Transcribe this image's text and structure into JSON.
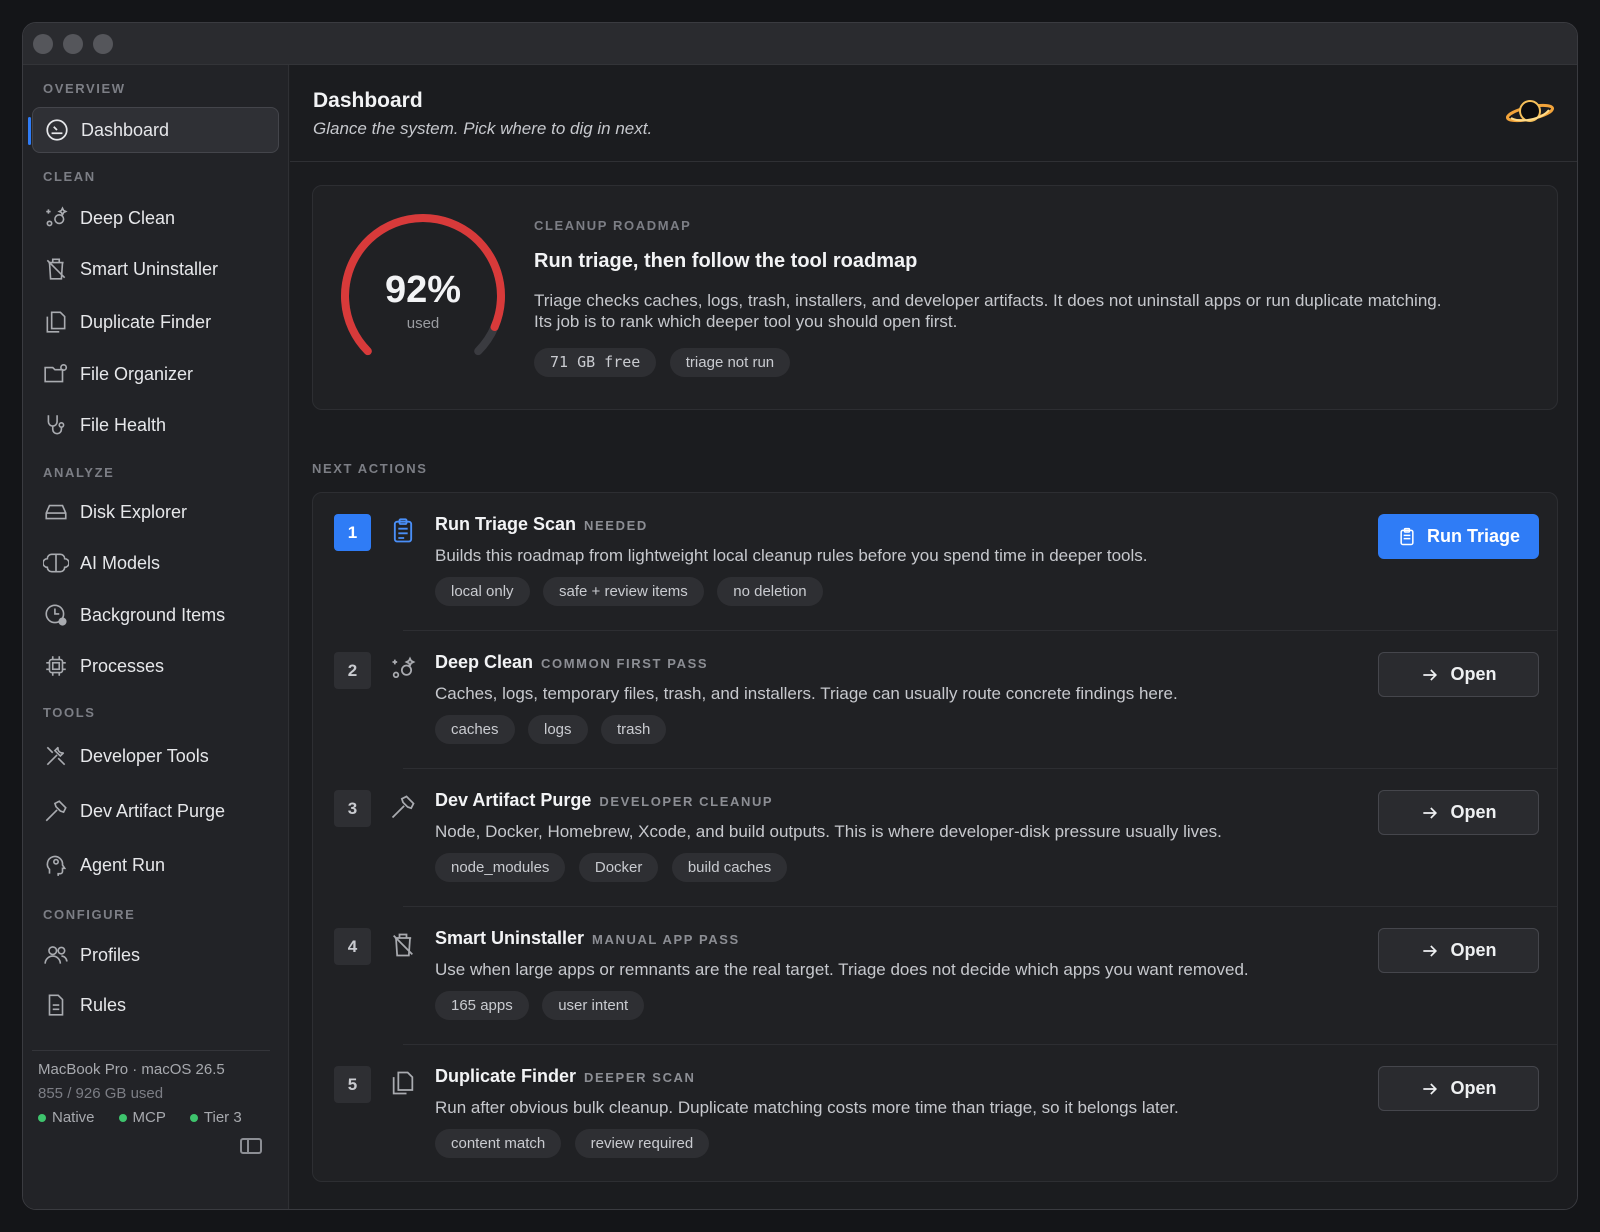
{
  "sidebar": {
    "sections": [
      "OVERVIEW",
      "CLEAN",
      "ANALYZE",
      "TOOLS",
      "CONFIGURE"
    ],
    "items": [
      {
        "label": "Dashboard",
        "icon": "gauge-icon",
        "active": true
      },
      {
        "label": "Deep Clean",
        "icon": "sparkles-icon"
      },
      {
        "label": "Smart Uninstaller",
        "icon": "trash-icon"
      },
      {
        "label": "Duplicate Finder",
        "icon": "documents-icon"
      },
      {
        "label": "File Organizer",
        "icon": "folder-gear-icon"
      },
      {
        "label": "File Health",
        "icon": "stethoscope-icon"
      },
      {
        "label": "Disk Explorer",
        "icon": "drive-icon"
      },
      {
        "label": "AI Models",
        "icon": "brain-icon"
      },
      {
        "label": "Background Items",
        "icon": "clock-badge-icon"
      },
      {
        "label": "Processes",
        "icon": "cpu-icon"
      },
      {
        "label": "Developer Tools",
        "icon": "tools-icon"
      },
      {
        "label": "Dev Artifact Purge",
        "icon": "hammer-icon"
      },
      {
        "label": "Agent Run",
        "icon": "agent-head-icon"
      },
      {
        "label": "Profiles",
        "icon": "people-icon"
      },
      {
        "label": "Rules",
        "icon": "document-icon"
      }
    ],
    "footer": {
      "device": "MacBook Pro · macOS 26.5",
      "usage": "855 / 926 GB used",
      "status": [
        "Native",
        "MCP",
        "Tier 3"
      ]
    }
  },
  "header": {
    "title": "Dashboard",
    "subtitle": "Glance the system. Pick where to dig in next."
  },
  "roadmap": {
    "gauge_value": "92%",
    "gauge_label": "used",
    "gauge_fraction": 0.92,
    "eyebrow": "CLEANUP ROADMAP",
    "title": "Run triage, then follow the tool roadmap",
    "desc1": "Triage checks caches, logs, trash, installers, and developer artifacts. It does not uninstall apps or run duplicate matching.",
    "desc2": "Its job is to rank which deeper tool you should open first.",
    "pills": [
      "71 GB free",
      "triage not run"
    ]
  },
  "next_actions_label": "NEXT ACTIONS",
  "actions": [
    {
      "num": "1",
      "title": "Run Triage Scan",
      "tag": "NEEDED",
      "desc": "Builds this roadmap from lightweight local cleanup rules before you spend time in deeper tools.",
      "pills": [
        "local only",
        "safe + review items",
        "no deletion"
      ],
      "button": "Run Triage"
    },
    {
      "num": "2",
      "title": "Deep Clean",
      "tag": "COMMON FIRST PASS",
      "desc": "Caches, logs, temporary files, trash, and installers. Triage can usually route concrete findings here.",
      "pills": [
        "caches",
        "logs",
        "trash"
      ],
      "button": "Open"
    },
    {
      "num": "3",
      "title": "Dev Artifact Purge",
      "tag": "DEVELOPER CLEANUP",
      "desc": "Node, Docker, Homebrew, Xcode, and build outputs. This is where developer-disk pressure usually lives.",
      "pills": [
        "node_modules",
        "Docker",
        "build caches"
      ],
      "button": "Open"
    },
    {
      "num": "4",
      "title": "Smart Uninstaller",
      "tag": "MANUAL APP PASS",
      "desc": "Use when large apps or remnants are the real target. Triage does not decide which apps you want removed.",
      "pills": [
        "165 apps",
        "user intent"
      ],
      "button": "Open"
    },
    {
      "num": "5",
      "title": "Duplicate Finder",
      "tag": "DEEPER SCAN",
      "desc": "Run after obvious bulk cleanup. Duplicate matching costs more time than triage, so it belongs later.",
      "pills": [
        "content match",
        "review required"
      ],
      "button": "Open"
    }
  ],
  "colors": {
    "accent": "#2f7cf6",
    "gauge": "#d83a3a",
    "status_dot": "#3ec46d"
  }
}
